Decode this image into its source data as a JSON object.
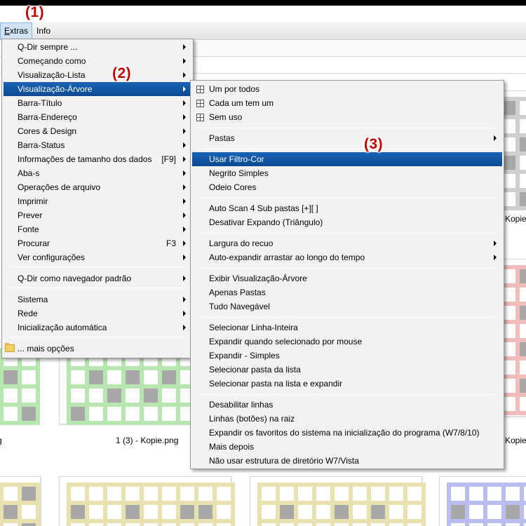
{
  "menubar": {
    "extras": "Extras",
    "extras_u": "E",
    "extras_rest": "xtras",
    "info": "Info"
  },
  "annotations": {
    "a1": "(1)",
    "a2": "(2)",
    "a3": "(3)"
  },
  "background": {
    "captions": {
      "c1": "Kopie",
      "c2": "Kopie",
      "c3": "1 (3) - Kopie.png",
      "c4": "Kopie",
      "c5": "g"
    }
  },
  "extras_menu": {
    "items": [
      {
        "label": "Q-Dir sempre ...",
        "submenu": true
      },
      {
        "label": "Começando como",
        "submenu": true
      },
      {
        "label": "Visualização-Lista",
        "submenu": true
      },
      {
        "label": "Visualização-Árvore",
        "submenu": true,
        "highlighted": true
      },
      {
        "label": "Barra-Título",
        "submenu": true
      },
      {
        "label": "Barra-Endereço",
        "submenu": true
      },
      {
        "label": "Cores & Design",
        "submenu": true
      },
      {
        "label": "Barra-Status",
        "submenu": true
      },
      {
        "label": "Informações de tamanho dos dados",
        "accel": "[F9]",
        "submenu": true
      },
      {
        "label": "Aba-s",
        "submenu": true
      },
      {
        "label": "Operações de arquivo",
        "submenu": true
      },
      {
        "label": "Imprimir",
        "submenu": true
      },
      {
        "label": "Prever",
        "submenu": true
      },
      {
        "label": "Fonte",
        "submenu": true
      },
      {
        "label": "Procurar",
        "accel": "F3",
        "submenu": true
      },
      {
        "label": "Ver configurações",
        "submenu": true
      },
      {
        "label": "Q-Dir como navegador padrão",
        "submenu": true
      },
      {
        "label": "Sistema",
        "submenu": true
      },
      {
        "label": "Rede",
        "submenu": true
      },
      {
        "label": "Inicialização automática",
        "submenu": true
      },
      {
        "label": "... mais opções",
        "submenu": false
      }
    ]
  },
  "tree_menu": {
    "items": [
      {
        "label": "Um por todos"
      },
      {
        "label": "Cada um tem um"
      },
      {
        "label": "Sem uso"
      },
      {
        "label": "Pastas",
        "submenu": true
      },
      {
        "label": "Usar Filtro-Cor",
        "highlighted": true
      },
      {
        "label": "Negrito Simples"
      },
      {
        "label": "Odeio Cores"
      },
      {
        "label": "Auto Scan 4 Sub pastas [+][ ]"
      },
      {
        "label": "Desativar Expando (Triângulo)"
      },
      {
        "label": "Largura do recuo",
        "submenu": true
      },
      {
        "label": "Auto-expandir arrastar ao longo do tempo",
        "submenu": true
      },
      {
        "label": "Exibir Visualização-Árvore"
      },
      {
        "label": "Apenas Pastas"
      },
      {
        "label": "Tudo Navegável"
      },
      {
        "label": "Selecionar Linha-Inteira"
      },
      {
        "label": "Expandir quando selecionado por mouse"
      },
      {
        "label": "Expandir - Simples"
      },
      {
        "label": "Selecionar pasta da lista"
      },
      {
        "label": "Selecionar pasta na lista e expandir"
      },
      {
        "label": "Desabilitar linhas"
      },
      {
        "label": "Linhas (botões) na raiz"
      },
      {
        "label": "Expandir os favoritos do sistema na inicialização do programa (W7/8/10)"
      },
      {
        "label": "Mais depois"
      },
      {
        "label": "Não usar estrutura de diretório W7/Vista"
      }
    ]
  },
  "colors": {
    "highlight": "#0a4a93",
    "annotation": "#c00000",
    "thumb_green": "#b8e6b0",
    "thumb_yellow": "#e8e2b0",
    "thumb_red": "#f1bcbc",
    "thumb_blue": "#b9bdf0",
    "thumb_gray": "#cfcfcf",
    "cell_dark": "#a8a8a8"
  }
}
